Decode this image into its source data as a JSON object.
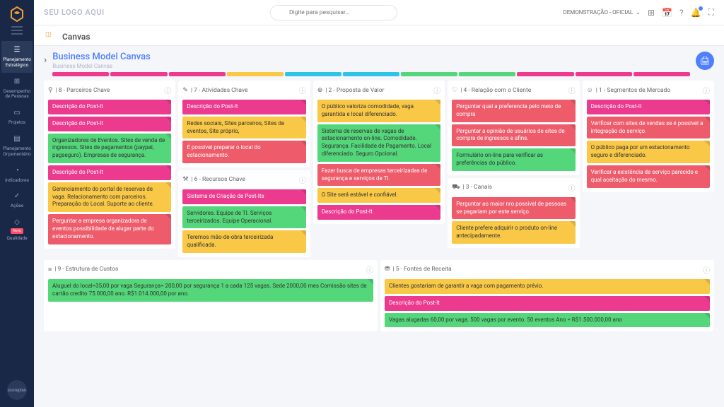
{
  "brand": "SEU LOGO AQUI",
  "search_placeholder": "Digite para pesquisar...",
  "demo_label": "DEMONSTRAÇÃO - OFICIAL",
  "canvas_header": "Canvas",
  "bmc_title": "Business Model Canvas",
  "bmc_sub": "Business Model Canvas",
  "footer_brand": "scoreplan",
  "nav": [
    {
      "label": "Planejamento Estratégico",
      "icon": "☰",
      "active": true
    },
    {
      "label": "Desempenho de Pessoas",
      "icon": "⊞"
    },
    {
      "label": "Projetos",
      "icon": "▭"
    },
    {
      "label": "Planejamento Orçamentário",
      "icon": "▤"
    },
    {
      "label": "Indicadores",
      "icon": "◔"
    },
    {
      "label": "Ações",
      "icon": "✓"
    },
    {
      "label": "Qualidade",
      "icon": "◇",
      "badge": "Novo"
    }
  ],
  "rainbow_colors": [
    "#ec3b8f",
    "#ec3b8f",
    "#ec3b8f",
    "#f9c846",
    "#2dc4e8",
    "#2dc4e8",
    "#54d67a",
    "#54d67a",
    "#ec3b8f",
    "#ec3b8f",
    "#ec3b8f"
  ],
  "sections": {
    "parceiros": {
      "title": "| 8 - Parceiros Chave",
      "icon": "⚲",
      "notes": [
        {
          "t": "Descrição do Post-It",
          "c": "#ec3b8f"
        },
        {
          "t": "Descrição do Post-It",
          "c": "#ec3b8f"
        },
        {
          "t": "Organizadores de Eventos. Sites de venda de ingressos. Sites de pagamentos (paypal, pagseguro). Empresas de segurança.",
          "c": "#54d67a"
        },
        {
          "t": "Descrição do Post-It",
          "c": "#ec3b8f"
        },
        {
          "t": "Gerenciamento do portal de reservas de vaga. Relacionamento com parceiros. Preparação do Local. Suporte ao cliente.",
          "c": "#f9c846"
        },
        {
          "t": "Perguntar a empresa organizadora de eventos possibilidade de alugar parte do estacionamento.",
          "c": "#ee5c6c"
        }
      ]
    },
    "atividades": {
      "title": "| 7 - Atividades Chave",
      "icon": "✎",
      "notes": [
        {
          "t": "Descrição do Post-It",
          "c": "#ec3b8f"
        },
        {
          "t": "Redes sociais, Sites parceiros, Sites de eventos, Site próprio,",
          "c": "#f9c846"
        },
        {
          "t": "É possível preparar o local do estacionamento.",
          "c": "#ee5c6c"
        }
      ]
    },
    "recursos": {
      "title": "| 6 - Recursos Chave",
      "icon": "⚒",
      "notes": [
        {
          "t": "Sistema de Criação de Post-Its",
          "c": "#ec3b8f"
        },
        {
          "t": "Servidores. Equipe de TI. Serviços terceirizados. Equipe Operacional.",
          "c": "#54d67a"
        },
        {
          "t": "Teremos mão-de-obra terceirizada qualificada.",
          "c": "#f9c846"
        }
      ]
    },
    "proposta": {
      "title": "| 2 - Proposta de Valor",
      "icon": "⊕",
      "notes": [
        {
          "t": "O público valoriza comodidade, vaga garantida e local diferenciado.",
          "c": "#f9c846"
        },
        {
          "t": "Sistema de reservas de vagas de estacionamento on-line. Comodidade. Segurança. Facilidade de Pagamento. Local diferenciado. Seguro Opcional.",
          "c": "#54d67a"
        },
        {
          "t": "Fazer busca de empresas terceirizadas de segurança e serviços de TI.",
          "c": "#ee5c6c"
        },
        {
          "t": "O Site será estável e confiável.",
          "c": "#f9c846"
        },
        {
          "t": "Descrição do Post-It",
          "c": "#ec3b8f"
        }
      ]
    },
    "relacao": {
      "title": "| 4 - Relação com o Cliente",
      "icon": "♡",
      "notes": [
        {
          "t": "Perguntar qual a preferencia pelo meio de compra",
          "c": "#ee5c6c"
        },
        {
          "t": "Perguntar a opinião de usuários de sites de compra de ingressos e afins.",
          "c": "#ee5c6c"
        },
        {
          "t": "Formulário on-line para verificar as preferências do público.",
          "c": "#54d67a"
        }
      ]
    },
    "canais": {
      "title": "| 3 - Canais",
      "icon": "⛟",
      "notes": [
        {
          "t": "Perguntar ao maior nro possível de pessoas se pagariam por este serviço.",
          "c": "#ee5c6c"
        },
        {
          "t": "Cliente prefere adquirir o produto on-line antecipadamente.",
          "c": "#f9c846"
        }
      ]
    },
    "segmentos": {
      "title": "| 1 - Segmentos de Mercado",
      "icon": "☺",
      "notes": [
        {
          "t": "Descrição do Post-It",
          "c": "#ec3b8f"
        },
        {
          "t": "Verificar com sites de vendas se é possível a integração do serviço.",
          "c": "#ee5c6c"
        },
        {
          "t": "O público paga por um estacionamento seguro e diferenciado.",
          "c": "#f9c846"
        },
        {
          "t": "Verificar a existência de serviço parecido e qual aceitação do mesmo.",
          "c": "#ee5c6c"
        }
      ]
    },
    "custos": {
      "title": "| 9 - Estrutura de Custos",
      "icon": "≡",
      "notes": [
        {
          "t": "Aluguel do local=35,00 por vaga Segurança= 200,00 por segurança 1 a cada 125 vagas. Sede 2000,00 mes Comissão sites de cartão credito 75.000,00 ano. R$1.014.000,00 por ano.",
          "c": "#54d67a"
        }
      ]
    },
    "receita": {
      "title": "| 5 - Fontes de Receita",
      "icon": "⛃",
      "notes": [
        {
          "t": "Clientes gostariam de garantir a vaga com pagamento prévio.",
          "c": "#f9c846"
        },
        {
          "t": "Descrição do Post-It",
          "c": "#ec3b8f"
        },
        {
          "t": "Vagas alugadas 60,00 por vaga. 500 vagas por evento. 50 eventos Ano = R$1.500.000,00 ano",
          "c": "#54d67a"
        }
      ]
    }
  }
}
